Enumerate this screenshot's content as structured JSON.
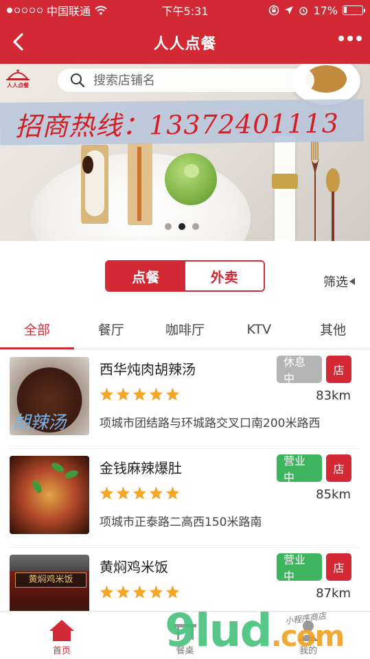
{
  "status_bar": {
    "carrier": "中国联通",
    "time": "下午5:31",
    "battery": "17%",
    "battery_fraction": 0.17
  },
  "nav": {
    "title": "人人点餐"
  },
  "banner": {
    "logo_text": "人人点餐",
    "search_placeholder": "搜索店铺名",
    "hotline": "招商热线：13372401113",
    "slide_count": 3,
    "active_slide": 2
  },
  "mode": {
    "dine_in": "点餐",
    "takeout": "外卖",
    "filter": "筛选"
  },
  "tabs": [
    "全部",
    "餐厅",
    "咖啡厅",
    "KTV",
    "其他"
  ],
  "restaurants": [
    {
      "name": "西华炖肉胡辣汤",
      "status": "休息中",
      "shop_label": "店",
      "distance": "83km",
      "address": "项城市团结路与环城路交叉口南200米路西",
      "rating": 5,
      "thumb_text": "胡辣汤"
    },
    {
      "name": "金钱麻辣爆肚",
      "status": "营业中",
      "shop_label": "店",
      "distance": "85km",
      "address": "项城市正泰路二高西150米路南",
      "rating": 5
    },
    {
      "name": "黄焖鸡米饭",
      "status": "营业中",
      "shop_label": "店",
      "distance": "87km",
      "address": "",
      "rating": 5,
      "thumb_text": "黄焖鸡米饭"
    }
  ],
  "bottom_nav": [
    "首页",
    "餐桌",
    "我的"
  ],
  "watermark": {
    "brand": "9lud",
    "suffix": ".com",
    "caption": "小程序商店"
  },
  "colors": {
    "primary": "#d22935",
    "open": "#3fb45f",
    "closed": "#b4b4b4",
    "star": "#f5a623"
  }
}
